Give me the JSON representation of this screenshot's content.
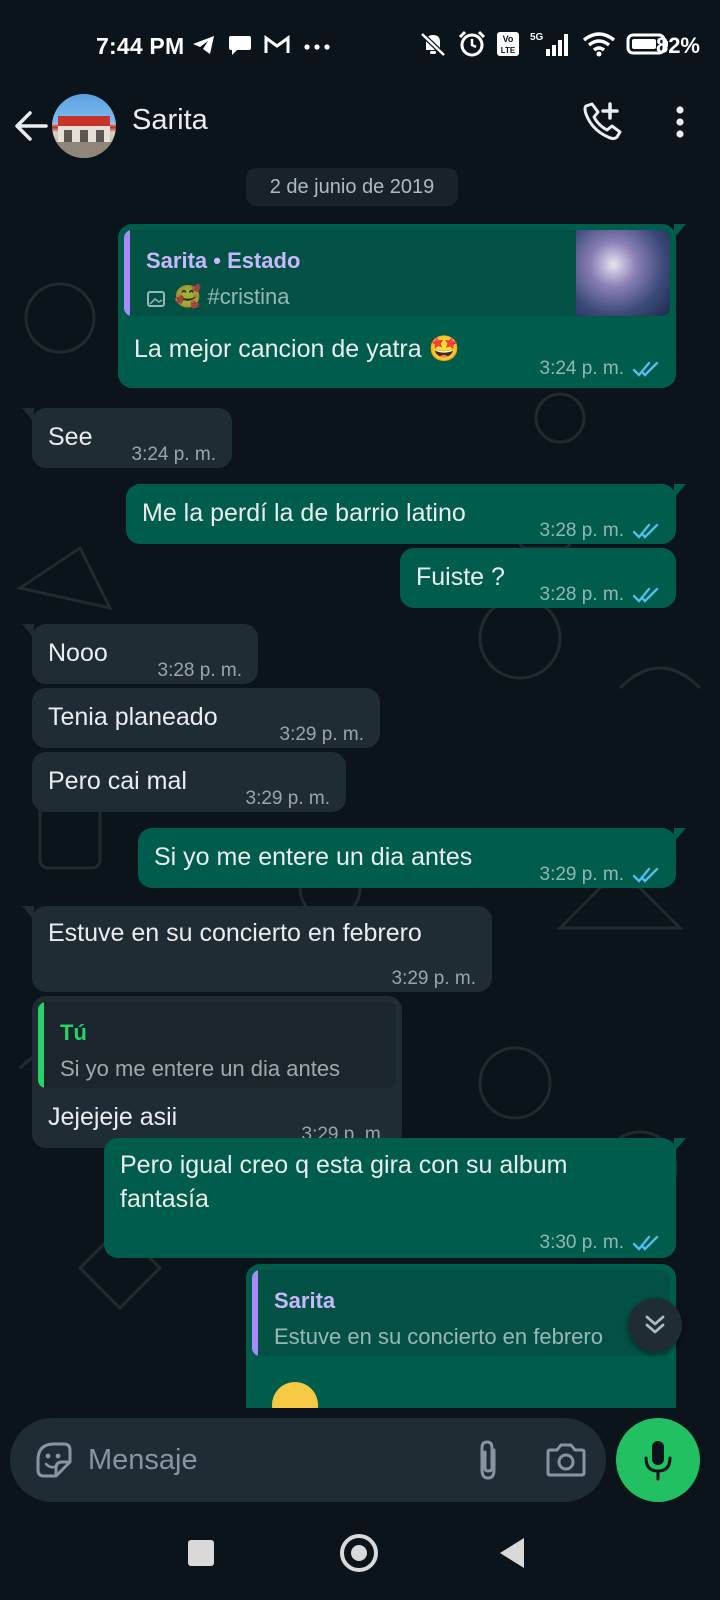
{
  "status_bar": {
    "time": "7:44 PM",
    "left_icons": [
      "telegram-icon",
      "chat-icon",
      "gmail-icon",
      "more-dots-icon"
    ],
    "right_icons": [
      "mute-icon",
      "alarm-icon",
      "volte-icon",
      "signal-icon",
      "wifi-icon",
      "battery-icon"
    ],
    "network": "5G",
    "volte": "Vo LTE",
    "battery": "82%"
  },
  "header": {
    "contact_name": "Sarita",
    "icons": [
      "back-arrow-icon",
      "add-call-icon",
      "more-vert-icon"
    ]
  },
  "chat": {
    "date_chip": "2 de junio de 2019",
    "messages": [
      {
        "dir": "out",
        "quote_title": "Sarita • Estado",
        "quote_text": "🥰 #cristina",
        "text": "La mejor cancion de yatra 🤩",
        "time": "3:24 p. m.",
        "status": "read"
      },
      {
        "dir": "in",
        "text": "See",
        "time": "3:24 p. m."
      },
      {
        "dir": "out",
        "text": "Me la perdí la de barrio latino",
        "time": "3:28 p. m.",
        "status": "read"
      },
      {
        "dir": "out",
        "text": "Fuiste ?",
        "time": "3:28 p. m.",
        "status": "read"
      },
      {
        "dir": "in",
        "text": "Nooo",
        "time": "3:28 p. m."
      },
      {
        "dir": "in",
        "text": "Tenia planeado",
        "time": "3:29 p. m."
      },
      {
        "dir": "in",
        "text": "Pero cai mal",
        "time": "3:29 p. m."
      },
      {
        "dir": "out",
        "text": "Si yo me entere un dia antes",
        "time": "3:29 p. m.",
        "status": "read"
      },
      {
        "dir": "in",
        "text": "Estuve en su concierto en febrero",
        "time": "3:29 p. m."
      },
      {
        "dir": "in",
        "quote_title": "Tú",
        "quote_text": "Si yo me entere un dia antes",
        "text": "Jejejeje asii",
        "time": "3:29 p. m."
      },
      {
        "dir": "out",
        "text_line1": "Pero igual creo q esta gira con su album",
        "text_line2": "fantasía",
        "time": "3:30 p. m.",
        "status": "read"
      },
      {
        "dir": "out",
        "quote_title": "Sarita",
        "quote_text": "Estuve en su concierto en febrero"
      }
    ]
  },
  "composer": {
    "placeholder": "Mensaje",
    "icons": [
      "emoji-sticker-icon",
      "attach-icon",
      "camera-icon",
      "mic-icon"
    ]
  },
  "colors": {
    "background": "#0b141a",
    "outgoing_bubble": "#005c4b",
    "incoming_bubble": "#202c33",
    "read_ticks": "#53bdeb",
    "mic_button": "#21c063",
    "quote_bar_contact": "#a78bfa",
    "quote_bar_self": "#25d366"
  }
}
